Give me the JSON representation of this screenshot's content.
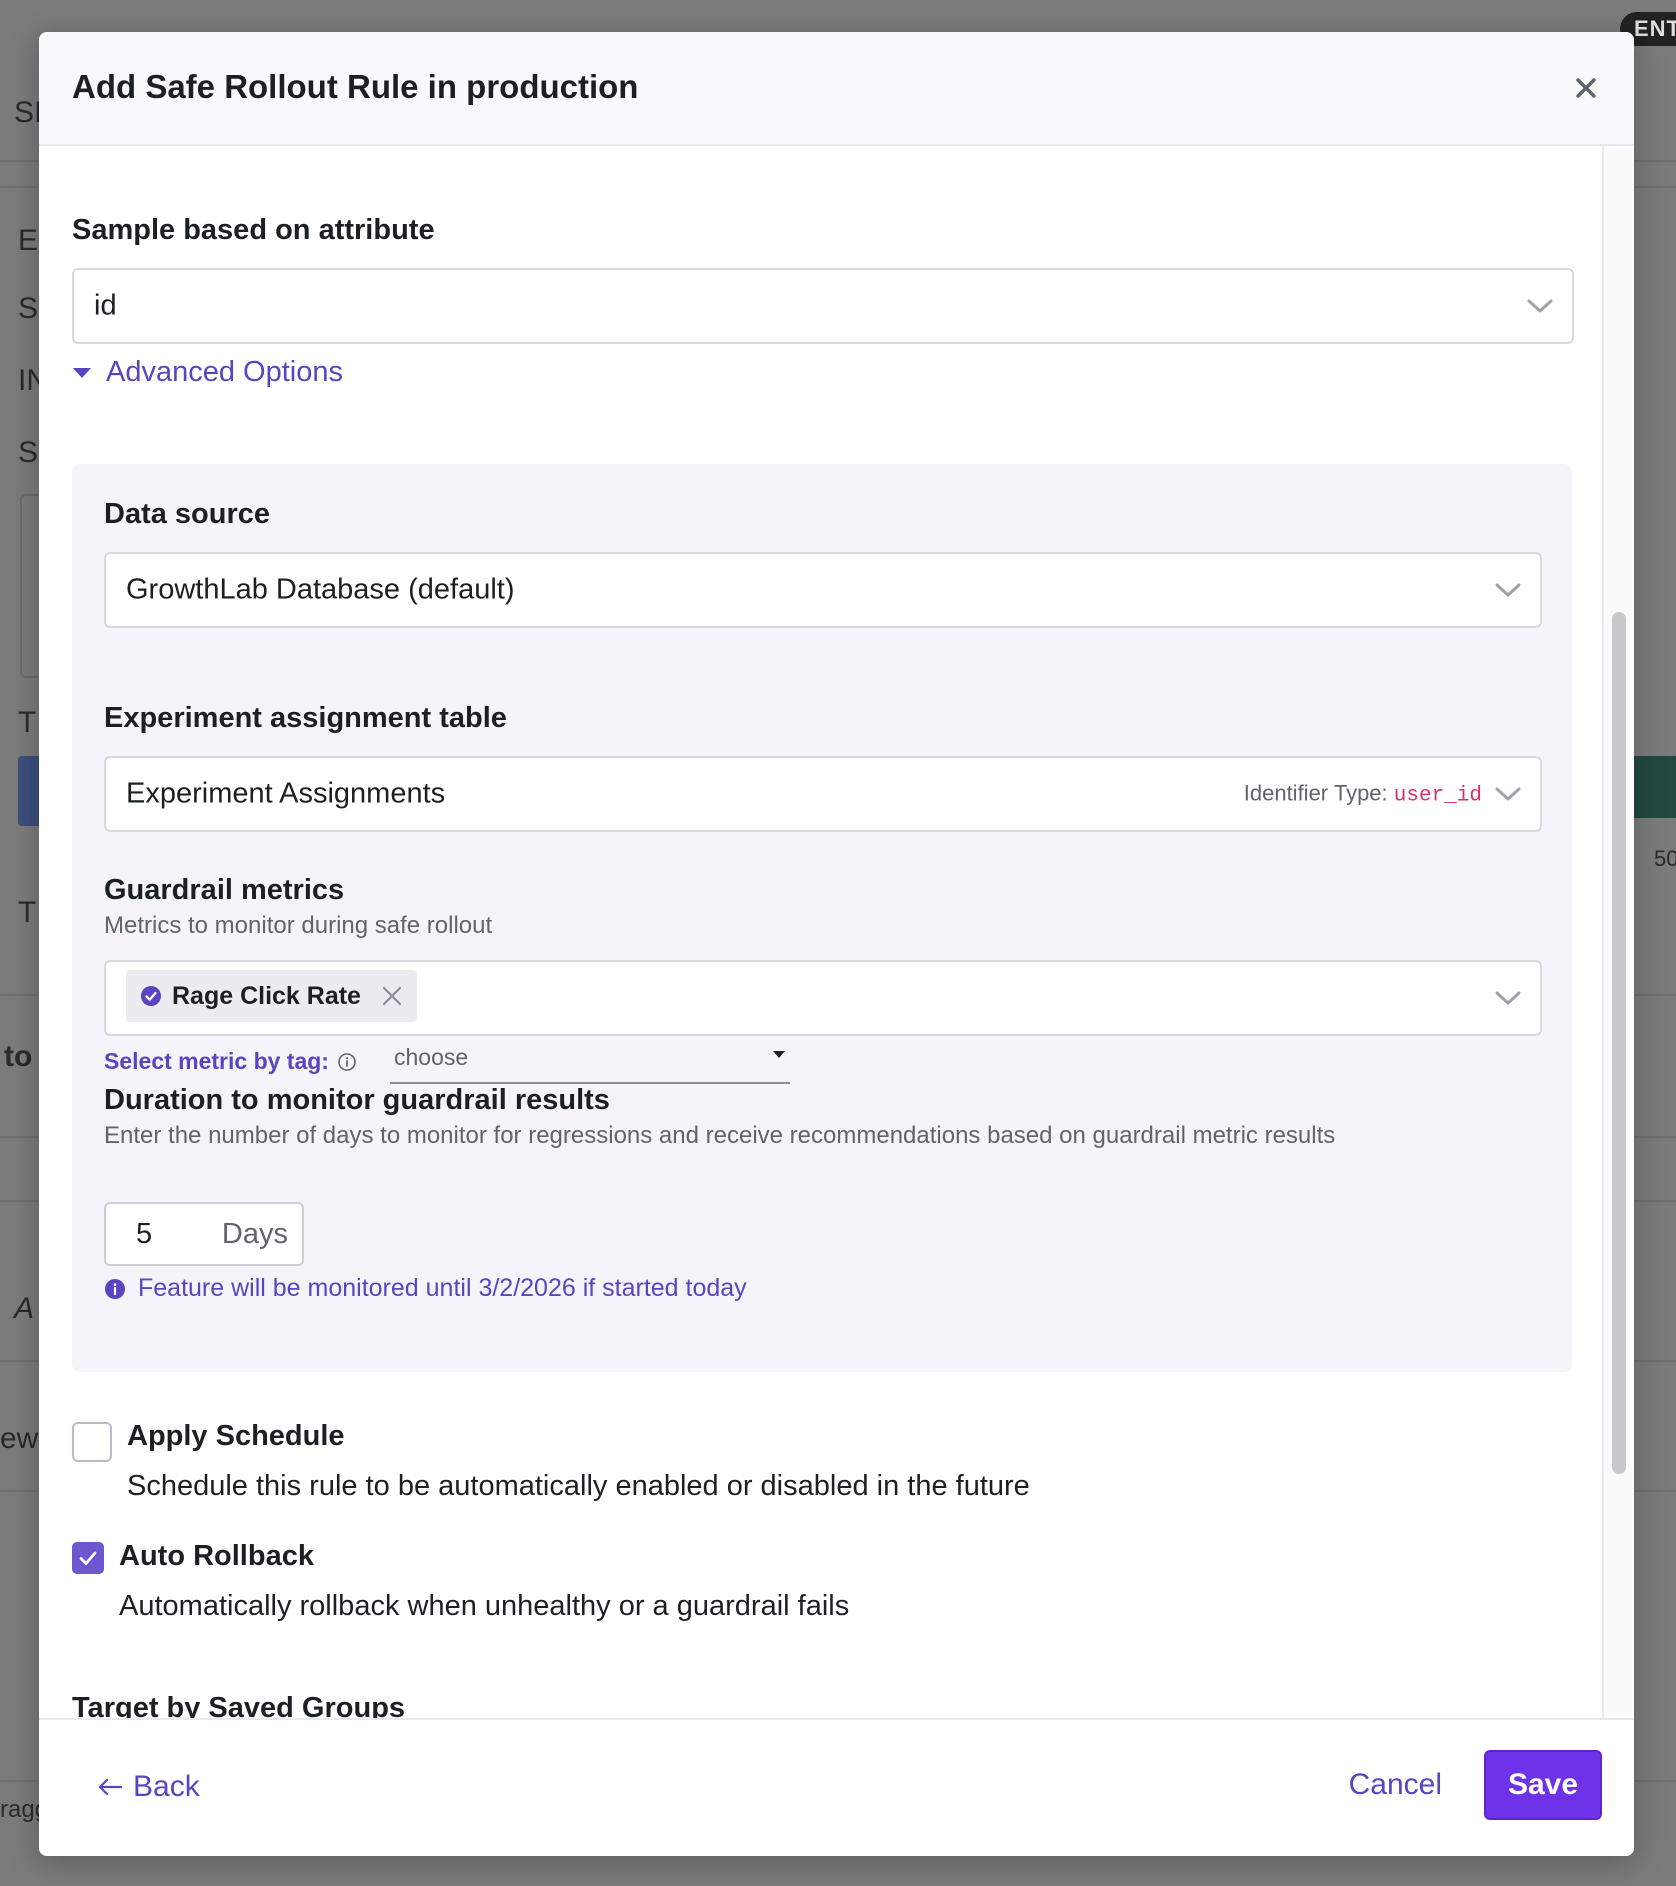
{
  "background": {
    "badge": "ENT",
    "snippets": [
      "SI",
      "E",
      "S",
      "IN",
      "S",
      "T",
      "T",
      "to",
      "A",
      "ew",
      "ragg",
      "50"
    ]
  },
  "modal": {
    "title": "Add Safe Rollout Rule in production",
    "close_icon": "close-icon"
  },
  "sample_attribute": {
    "label": "Sample based on attribute",
    "value": "id"
  },
  "advanced": {
    "toggle_label": "Advanced Options",
    "expanded": true,
    "data_source": {
      "label": "Data source",
      "value": "GrowthLab Database (default)"
    },
    "assignment_table": {
      "label": "Experiment assignment table",
      "value": "Experiment Assignments",
      "identifier_prefix": "Identifier Type:",
      "identifier_value": "user_id"
    },
    "guardrail": {
      "label": "Guardrail metrics",
      "help": "Metrics to monitor during safe rollout",
      "selected": [
        "Rage Click Rate"
      ],
      "tag_label": "Select metric by tag:",
      "tag_placeholder": "choose"
    },
    "duration": {
      "label": "Duration to monitor guardrail results",
      "help": "Enter the number of days to monitor for regressions and receive recommendations based on guardrail metric results",
      "value": "5",
      "unit": "Days",
      "note": "Feature will be monitored until 3/2/2026 if started today"
    }
  },
  "apply_schedule": {
    "checked": false,
    "title": "Apply Schedule",
    "description": "Schedule this rule to be automatically enabled or disabled in the future"
  },
  "auto_rollback": {
    "checked": true,
    "title": "Auto Rollback",
    "description": "Automatically rollback when unhealthy or a guardrail fails"
  },
  "saved_groups": {
    "label": "Target by Saved Groups"
  },
  "footer": {
    "back_label": "Back",
    "cancel_label": "Cancel",
    "save_label": "Save"
  },
  "colors": {
    "accent": "#6e56cf",
    "link": "#5b44c0",
    "primary_button": "#6e33e8",
    "panel_bg": "#f5f4fa",
    "identifier_code": "#d6336c"
  }
}
